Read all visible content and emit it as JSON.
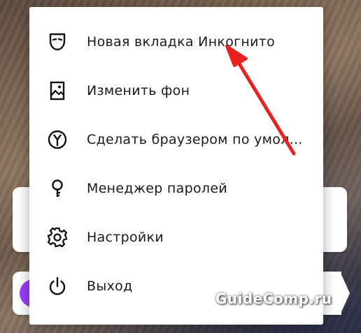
{
  "menu": {
    "items": [
      {
        "label": "Новая вкладка Инкогнито",
        "icon": "incognito-mask-icon"
      },
      {
        "label": "Изменить фон",
        "icon": "image-icon"
      },
      {
        "label": "Сделать браузером по умол...",
        "icon": "yandex-browser-icon"
      },
      {
        "label": "Менеджер паролей",
        "icon": "key-icon"
      },
      {
        "label": "Настройки",
        "icon": "gear-icon"
      },
      {
        "label": "Выход",
        "icon": "power-icon"
      }
    ]
  },
  "watermark": {
    "text": "GuideComp.ru"
  },
  "colors": {
    "annotation_arrow": "#e8231f",
    "accent_button": "#9b3dff",
    "menu_background": "#ffffff",
    "menu_text": "#1a1a1a"
  }
}
